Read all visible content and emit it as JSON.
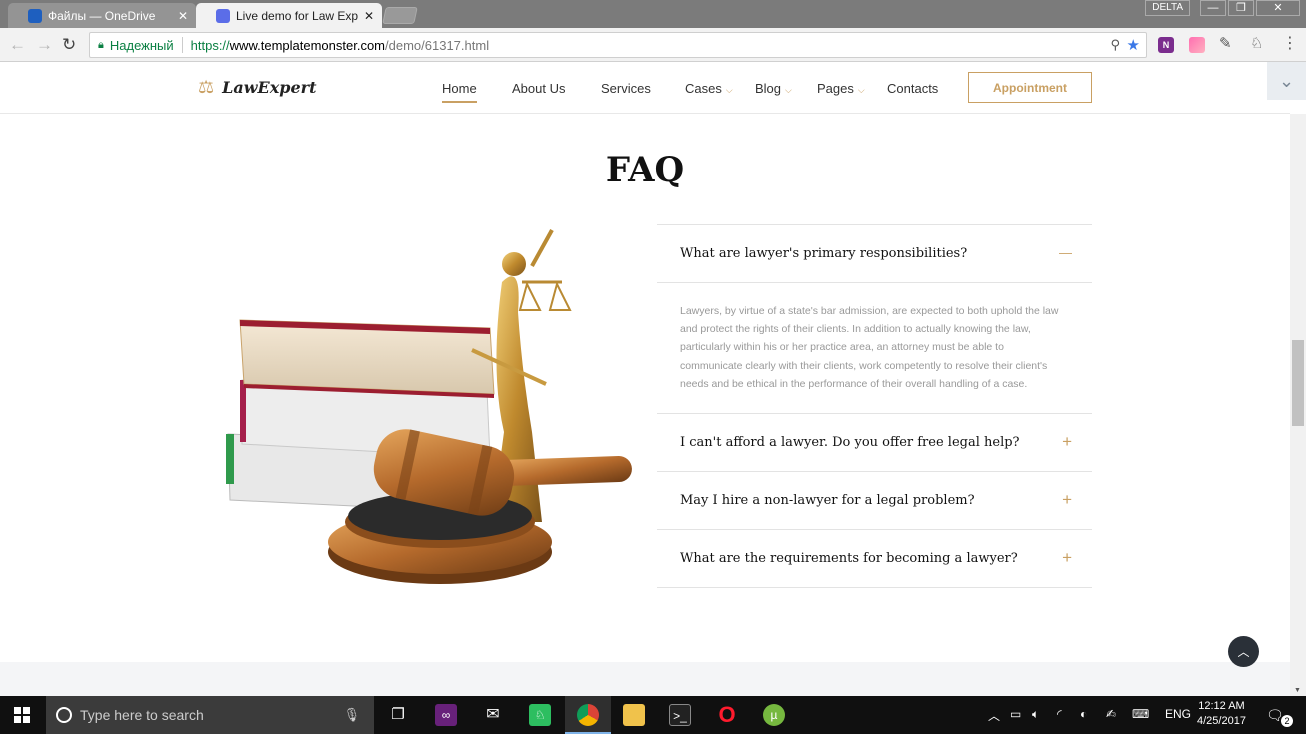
{
  "browser": {
    "tabs": [
      {
        "title": "Файлы — OneDrive",
        "active": false
      },
      {
        "title": "Live demo for Law Expert",
        "active": true
      }
    ],
    "window_label": "DELTA",
    "secure_label": "Надежный",
    "url": {
      "scheme": "https://",
      "host": "www.templatemonster.com",
      "path": "/demo/61317.html"
    }
  },
  "site": {
    "logo": "LawExpert",
    "nav": [
      {
        "label": "Home",
        "dropdown": false,
        "active": true
      },
      {
        "label": "About Us",
        "dropdown": false
      },
      {
        "label": "Services",
        "dropdown": false
      },
      {
        "label": "Cases",
        "dropdown": true
      },
      {
        "label": "Blog",
        "dropdown": true
      },
      {
        "label": "Pages",
        "dropdown": true
      },
      {
        "label": "Contacts",
        "dropdown": false
      }
    ],
    "cta": "Appointment",
    "accent_color": "#c9a063"
  },
  "faq": {
    "title": "FAQ",
    "items": [
      {
        "question": "What are lawyer's primary responsibilities?",
        "expanded": true,
        "toggle": "—",
        "answer": "Lawyers, by virtue of a state's bar admission, are expected to both uphold the law and protect the rights of their clients. In addition to actually knowing the law, particularly within his or her practice area, an attorney must be able to communicate clearly with their clients, work competently to resolve their client's needs and be ethical in the performance of their overall handling of a case."
      },
      {
        "question": "I can't afford a lawyer. Do you offer free legal help?",
        "expanded": false,
        "toggle": "+"
      },
      {
        "question": "May I hire a non-lawyer for a legal problem?",
        "expanded": false,
        "toggle": "+"
      },
      {
        "question": "What are the requirements for becoming a lawyer?",
        "expanded": false,
        "toggle": "+"
      }
    ]
  },
  "taskbar": {
    "search_placeholder": "Type here to search",
    "language": "ENG",
    "time": "12:12 AM",
    "date": "4/25/2017",
    "notifications": "2"
  }
}
